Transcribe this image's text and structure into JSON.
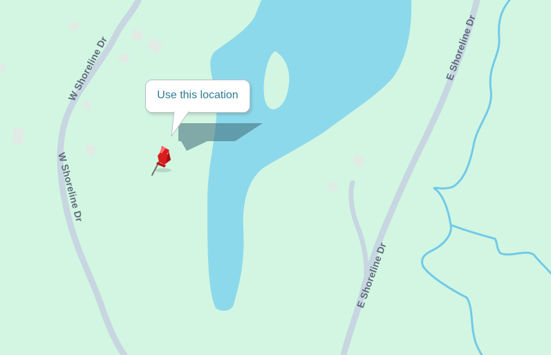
{
  "map": {
    "colors": {
      "land": "#d2f6e2",
      "water": "#8dd9ec",
      "road": "#c7d6e1",
      "stream": "#72c9e8",
      "label": "#5f6b7c",
      "pin": "#d91c1c"
    },
    "roads": {
      "west_label_upper": "W Shoreline Dr",
      "west_label_lower": "W Shoreline Dr",
      "east_label_upper": "E Shoreline Dr",
      "east_label_lower": "E Shoreline Dr"
    },
    "marker": {
      "icon": "pushpin-icon",
      "callout_label": "Use this location"
    }
  }
}
